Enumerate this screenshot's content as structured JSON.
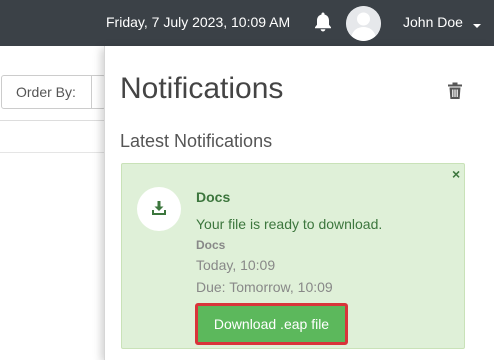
{
  "topbar": {
    "datetime": "Friday, 7 July 2023, 10:09 AM",
    "user_name": "John Doe",
    "icons": {
      "bell": "bell-icon",
      "avatar": "user-avatar-icon",
      "caret": "caret-down-icon"
    },
    "background_color": "#3b4147"
  },
  "background": {
    "order_by_label": "Order By:"
  },
  "notifications": {
    "title": "Notifications",
    "section_title": "Latest Notifications",
    "trash_icon": "trash-icon",
    "items": [
      {
        "title": "Docs",
        "message": "Your file is ready to download.",
        "source": "Docs",
        "time": "Today, 10:09",
        "due": "Due: Tomorrow, 10:09",
        "action_label": "Download .eap file",
        "close_label": "×",
        "icon": "download-icon"
      }
    ],
    "colors": {
      "card_background": "#dff0d8",
      "text_green": "#3c763d",
      "button_green": "#5cb85c",
      "highlight_red": "#d9343a"
    }
  }
}
